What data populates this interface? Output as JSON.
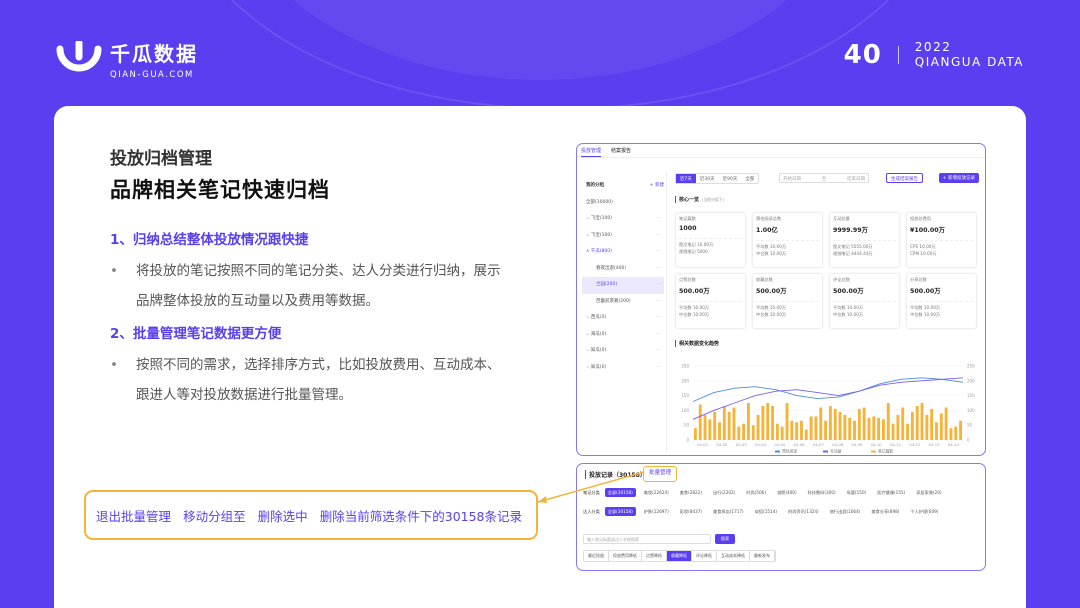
{
  "brand": {
    "name": "千瓜数据",
    "domain": "QIAN-GUA.COM"
  },
  "page": {
    "number": "40",
    "year": "2022",
    "series": "QIANGUA DATA"
  },
  "section": {
    "label": "投放归档管理",
    "headline": "品牌相关笔记快速归档",
    "points": [
      {
        "heading": "1、归纳总结整体投放情况跟快捷",
        "body": "将投放的笔记按照不同的笔记分类、达人分类进行归纳，展示品牌整体投放的互动量以及费用等数据。"
      },
      {
        "heading": "2、批量管理笔记数据更方便",
        "body": "按照不同的需求，选择排序方式，比如投放费用、互动成本、跟进人等对投放数据进行批量管理。"
      }
    ]
  },
  "callout": {
    "actions": [
      "退出批量管理",
      "移动分组至",
      "删除选中",
      "删除当前筛选条件下的30158条记录"
    ]
  },
  "screen1": {
    "tabs": [
      "投放管理",
      "结案报告"
    ],
    "sidebar": {
      "title": "我的分组",
      "add": "+ 新建",
      "items": [
        "全部(10000)",
        "飞宝(100)",
        "飞宝(100)",
        "千瓜(800)",
        "春夜出遊(400)",
        "兰园(200)",
        "芭蕾前景奢(200)",
        "西瓜(0)",
        "海瓜(0)",
        "知瓜(0)",
        "知瓜(0)"
      ]
    },
    "periods": [
      "近7天",
      "近30天",
      "近90天",
      "全部"
    ],
    "date_range": {
      "start": "开始日期",
      "end": "结束日期"
    },
    "buttons": [
      "生成结案报告",
      "+ 新增投放记录"
    ],
    "core_title": "核心一览",
    "core_note": "(当前分组下)",
    "metrics": [
      {
        "label": "笔记篇数",
        "value": "1000",
        "subs": [
          "图文笔记 10.00万",
          "视频笔记 5000"
        ]
      },
      {
        "label": "预估阅读总数",
        "value": "1.00亿",
        "subs": [
          "平均数 10.00万",
          "中位数 10.00万"
        ]
      },
      {
        "label": "互动总量",
        "value": "9999.99万",
        "subs": [
          "图文笔记 5555.00万",
          "视频笔记 4444.44万"
        ]
      },
      {
        "label": "投放总费用",
        "value": "¥100.00万",
        "subs": [
          "CPE 10.00万",
          "CPM 10.00万"
        ]
      },
      {
        "label": "点赞总数",
        "value": "500.00万",
        "subs": [
          "平均数 10.00万",
          "中位数 10.00万"
        ]
      },
      {
        "label": "收藏总数",
        "value": "500.00万",
        "subs": [
          "平均数 10.00万",
          "中位数 10.00万"
        ]
      },
      {
        "label": "评论总数",
        "value": "500.00万",
        "subs": [
          "平均数 10.00万",
          "中位数 10.00万"
        ]
      },
      {
        "label": "分享总数",
        "value": "500.00万",
        "subs": [
          "平均数 10.00万",
          "中位数 10.00万"
        ]
      }
    ],
    "trend_title": "相关数据变化趋势",
    "chart_data": {
      "type": "bar",
      "categories": [
        "04-01",
        "04-02",
        "04-03",
        "04-04",
        "04-05",
        "04-06",
        "04-07",
        "04-08",
        "04-09",
        "04-10",
        "04-11",
        "04-12",
        "04-13",
        "04-14"
      ],
      "bars": [
        40,
        120,
        85,
        70,
        95,
        60,
        115,
        95,
        110,
        45,
        55,
        125,
        50,
        85,
        115,
        125,
        115,
        55,
        45,
        125,
        65,
        60,
        65,
        35,
        80,
        80,
        110,
        65,
        115,
        105,
        95,
        85,
        75,
        65,
        105,
        110,
        75,
        80,
        75,
        70,
        125,
        55,
        85,
        110,
        55,
        95,
        115,
        125,
        85,
        105,
        60,
        90,
        110,
        40,
        45,
        65
      ],
      "series": [
        {
          "name": "预估阅读",
          "color": "#4a90e2"
        },
        {
          "name": "互动量",
          "color": "#7b5cf5"
        },
        {
          "name": "笔记篇数",
          "color": "#f6b33a"
        }
      ],
      "y_left_ticks": [
        "0",
        "50",
        "100",
        "150",
        "200",
        "250"
      ],
      "y_right_ticks": [
        "0",
        "50",
        "100",
        "150",
        "200",
        "250"
      ],
      "ylim": [
        0,
        250
      ]
    }
  },
  "screen2": {
    "title": "投放记录（30158）",
    "batch": "批量管理",
    "note_filter": {
      "label": "笔记分类",
      "chips": [
        "全部(30158)",
        "美妆(22624)",
        "美食(2822)",
        "出行(2202)",
        "时尚(506)",
        "减肥(400)",
        "科技数码(300)",
        "母婴(150)",
        "医疗健康(155)",
        "家居家装(20)"
      ]
    },
    "kol_filter": {
      "label": "达人分类",
      "chips": [
        "全部(30158)",
        "护肤(12697)",
        "彩妆(8437)",
        "美食探店(1717)",
        "穿搭(1514)",
        "时尚资讯(1324)",
        "旅行出游(1064)",
        "美食分享(898)",
        "个人护理(609)"
      ]
    },
    "search_placeholder": "输入笔记标题或达人名称搜索",
    "search_btn": "搜索",
    "sort": [
      "最近投放",
      "投放费用降低",
      "点赞降低",
      "收藏降低",
      "评论降低",
      "互动成本降低",
      "最新发布"
    ]
  }
}
